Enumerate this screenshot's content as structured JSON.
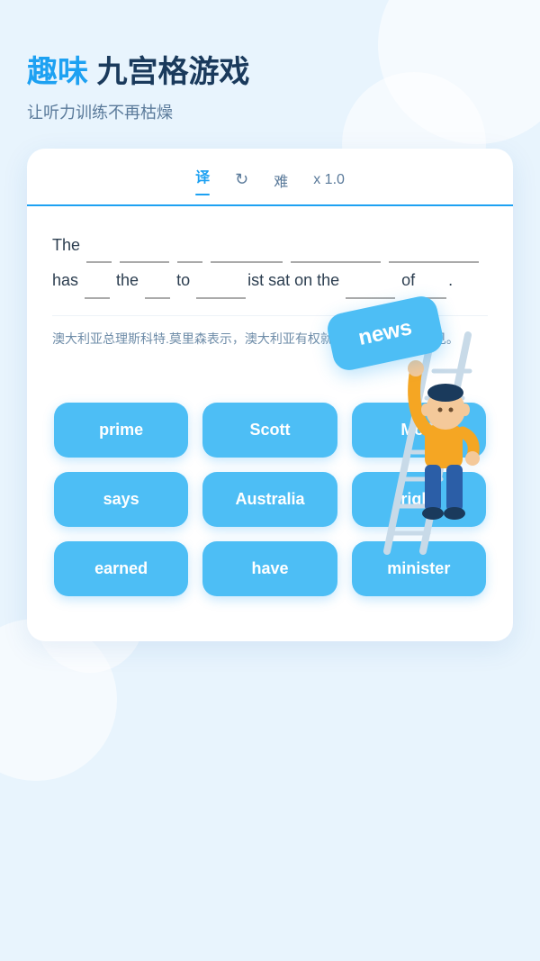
{
  "header": {
    "title_highlight": "趣味",
    "title_rest": " 九宫格游戏",
    "subtitle": "让听力训练不再枯燥"
  },
  "toolbar": {
    "translate_label": "译",
    "refresh_icon": "↻",
    "difficulty_label": "难",
    "speed_label": "x 1.0"
  },
  "sentence": {
    "text": "The ___ ______ ___ _________ _____ _______has ___ the ___ to _____ist sat on the ____ of ____."
  },
  "translation": {
    "text": "澳大利亚总理斯科特.莫里森表示，澳大利亚有权就以色列首都发表意见。"
  },
  "floating_word": {
    "label": "news"
  },
  "word_grid": {
    "words": [
      "prime",
      "Scott",
      "Morr",
      "says",
      "Australia",
      "right",
      "earned",
      "have",
      "minister"
    ]
  }
}
